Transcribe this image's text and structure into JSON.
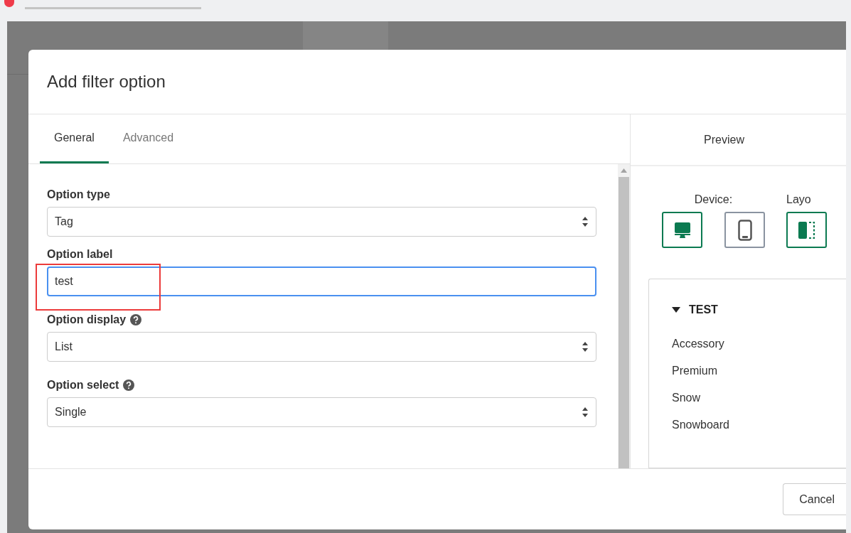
{
  "dialog": {
    "title": "Add filter option",
    "tabs": [
      {
        "label": "General",
        "selected": true
      },
      {
        "label": "Advanced",
        "selected": false
      }
    ],
    "fields": [
      {
        "kind": "select",
        "label": "Option type",
        "value": "Tag",
        "help": false,
        "focused": false,
        "annotated": false
      },
      {
        "kind": "text",
        "label": "Option label",
        "value": "test",
        "help": false,
        "focused": true,
        "annotated": true
      },
      {
        "kind": "select",
        "label": "Option display",
        "value": "List",
        "help": true,
        "focused": false,
        "annotated": false
      },
      {
        "kind": "select",
        "label": "Option select",
        "value": "Single",
        "help": true,
        "focused": false,
        "annotated": false
      }
    ],
    "preview": {
      "title": "Preview",
      "device_label": "Device:",
      "layout_label": "Layo",
      "devices": [
        {
          "kind": "desktop",
          "selected": true
        },
        {
          "kind": "mobile",
          "selected": false
        }
      ],
      "layouts": [
        {
          "kind": "sidebar",
          "selected": true
        }
      ],
      "filter": {
        "title": "TEST",
        "expanded": true,
        "options": [
          "Accessory",
          "Premium",
          "Snow",
          "Snowboard"
        ]
      }
    },
    "buttons": [
      {
        "label": "Cancel"
      }
    ]
  }
}
